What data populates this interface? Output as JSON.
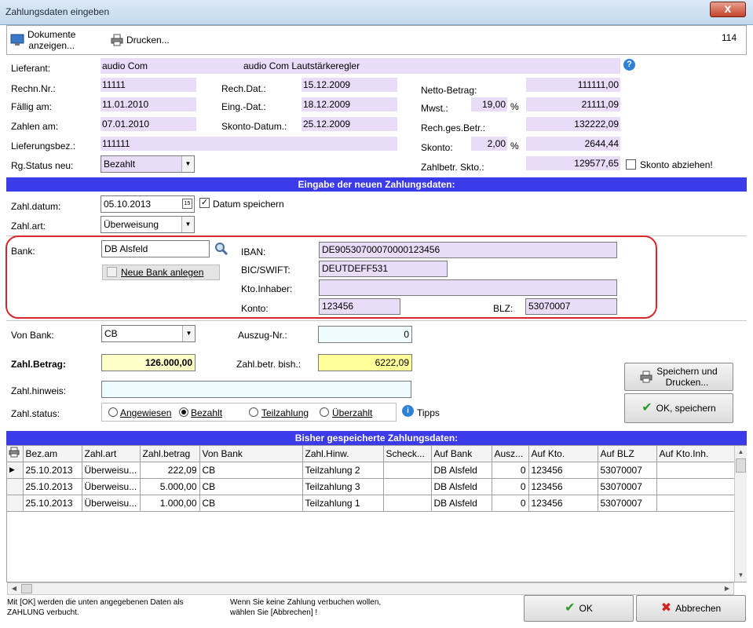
{
  "window": {
    "title": "Zahlungsdaten eingeben",
    "close_glyph": "x"
  },
  "toolbar": {
    "docs_label": "Dokumente\nanzeigen...",
    "print_label": "Drucken...",
    "page_number": "114"
  },
  "header": {
    "lieferant_label": "Lieferant:",
    "lieferant_value": "audio Com",
    "lieferant_desc": "audio Com Lautstärkeregler",
    "rechn_nr_label": "Rechn.Nr.:",
    "rechn_nr_value": "11111",
    "faellig_label": "Fällig am:",
    "faellig_value": "11.01.2010",
    "zahlen_label": "Zahlen am:",
    "zahlen_value": "07.01.2010",
    "lieferungsbez_label": "Lieferungsbez.:",
    "lieferungsbez_value": "111111",
    "rgstatus_label": "Rg.Status neu:",
    "rgstatus_value": "Bezahlt",
    "rechdat_label": "Rech.Dat.:",
    "rechdat_value": "15.12.2009",
    "eingdat_label": "Eing.-Dat.:",
    "eingdat_value": "18.12.2009",
    "skontodatum_label": "Skonto-Datum.:",
    "skontodatum_value": "25.12.2009",
    "netto_label": "Netto-Betrag:",
    "netto_value": "111111,00",
    "mwst_label": "Mwst.:",
    "mwst_pct": "19,00",
    "mwst_value": "21111,09",
    "pct_sign": "%",
    "rechges_label": "Rech.ges.Betr.:",
    "rechges_value": "132222,09",
    "skonto_label": "Skonto:",
    "skonto_pct": "2,00",
    "skonto_value": "2644,44",
    "zahlbetr_label": "Zahlbetr. Skto.:",
    "zahlbetr_value": "129577,65",
    "skonto_abziehen_label": "Skonto abziehen!"
  },
  "section1_title": "Eingabe der neuen Zahlungsdaten:",
  "entry": {
    "zahldatum_label": "Zahl.datum:",
    "zahldatum_value": "05.10.2013",
    "cal_icon_text": "15",
    "datum_speichern_label": "Datum speichern",
    "zahlart_label": "Zahl.art:",
    "zahlart_value": "Überweisung"
  },
  "bank": {
    "bank_label": "Bank:",
    "bank_value": "DB Alsfeld",
    "neue_bank_label": "Neue Bank anlegen",
    "iban_label": "IBAN:",
    "iban_value": "DE90530700070000123456",
    "bic_label": "BIC/SWIFT:",
    "bic_value": "DEUTDEFF531",
    "ktoinhaber_label": "Kto.Inhaber:",
    "ktoinhaber_value": "",
    "konto_label": "Konto:",
    "konto_value": "123456",
    "blz_label": "BLZ:",
    "blz_value": "53070007"
  },
  "payment": {
    "vonbank_label": "Von Bank:",
    "vonbank_value": "CB",
    "auszug_label": "Auszug-Nr.:",
    "auszug_value": "0",
    "betrag_label": "Zahl.Betrag:",
    "betrag_value": "126.000,00",
    "bisher_label": "Zahl.betr. bish.:",
    "bisher_value": "6222,09",
    "hinweis_label": "Zahl.hinweis:",
    "hinweis_value": "",
    "status_label": "Zahl.status:",
    "status_options": [
      "Angewiesen",
      "Bezahlt",
      "Teilzahlung",
      "Überzahlt"
    ],
    "status_selected": "Bezahlt",
    "tipps_label": "Tipps"
  },
  "actions": {
    "save_print_label": "Speichern und\nDrucken...",
    "ok_save_label": "OK, speichern",
    "ok_label": "OK",
    "cancel_label": "Abbrechen"
  },
  "section2_title": "Bisher gespeicherte Zahlungsdaten:",
  "table": {
    "columns": [
      "Bez.am",
      "Zahl.art",
      "Zahl.betrag",
      "Von Bank",
      "Zahl.Hinw.",
      "Scheck...",
      "Auf Bank",
      "Ausz...",
      "Auf Kto.",
      "Auf BLZ",
      "Auf Kto.Inh."
    ],
    "rows": [
      [
        "25.10.2013",
        "Überweisu...",
        "222,09",
        "CB",
        "Teilzahlung 2",
        "",
        "DB Alsfeld",
        "0",
        "123456",
        "53070007",
        ""
      ],
      [
        "25.10.2013",
        "Überweisu...",
        "5.000,00",
        "CB",
        "Teilzahlung 3",
        "",
        "DB Alsfeld",
        "0",
        "123456",
        "53070007",
        ""
      ],
      [
        "25.10.2013",
        "Überweisu...",
        "1.000,00",
        "CB",
        "Teilzahlung 1",
        "",
        "DB Alsfeld",
        "0",
        "123456",
        "53070007",
        ""
      ]
    ]
  },
  "footer": {
    "note_left": "Mit [OK] werden die unten angegebenen Daten als\nZAHLUNG verbucht.",
    "note_right": "Wenn Sie keine Zahlung verbuchen wollen,\nwählen Sie [Abbrechen] !"
  },
  "colors": {
    "section_bar": "#3b3bea",
    "readonly_purple": "#e8dcf8",
    "highlight_red": "#d9262c",
    "amount_yellow": "#ffffc8"
  }
}
